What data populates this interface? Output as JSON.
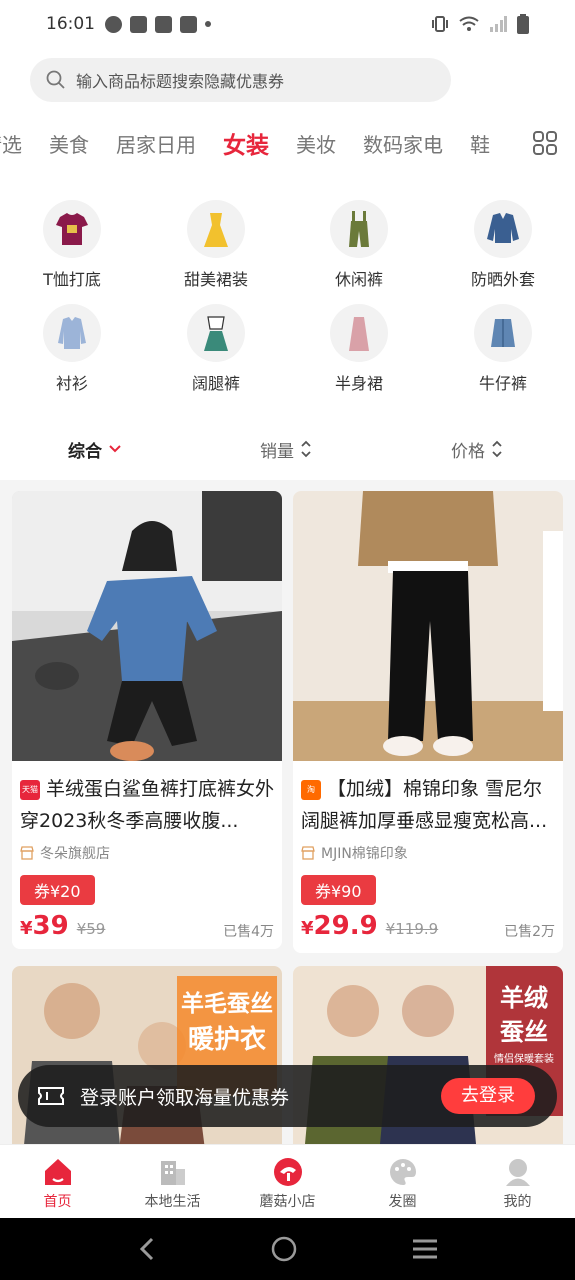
{
  "status": {
    "time": "16:01"
  },
  "search": {
    "placeholder": "输入商品标题搜索隐藏优惠券"
  },
  "categories": [
    {
      "label": "精选"
    },
    {
      "label": "美食"
    },
    {
      "label": "居家日用"
    },
    {
      "label": "女装"
    },
    {
      "label": "美妆"
    },
    {
      "label": "数码家电"
    },
    {
      "label": "鞋"
    }
  ],
  "active_category": "女装",
  "subcategories": [
    {
      "label": "T恤打底",
      "icon": "tshirt-icon"
    },
    {
      "label": "甜美裙装",
      "icon": "dress-icon"
    },
    {
      "label": "休闲裤",
      "icon": "overalls-icon"
    },
    {
      "label": "防晒外套",
      "icon": "jacket-icon"
    },
    {
      "label": "衬衫",
      "icon": "shirt-icon"
    },
    {
      "label": "阔腿裤",
      "icon": "wide-pants-icon"
    },
    {
      "label": "半身裙",
      "icon": "skirt-icon"
    },
    {
      "label": "牛仔裤",
      "icon": "denim-skirt-icon"
    }
  ],
  "sort": {
    "comprehensive": "综合",
    "sales": "销量",
    "price": "价格"
  },
  "products": [
    {
      "badge": "天猫",
      "title": "羊绒蛋白鲨鱼裤打底裤女外穿2023秋冬季高腰收腹...",
      "shop": "冬朵旗舰店",
      "coupon": "券¥20",
      "price_symbol": "¥",
      "price": "39",
      "original_price": "¥59",
      "sold": "已售4万"
    },
    {
      "badge": "淘",
      "title": "【加绒】棉锦印象 雪尼尔阔腿裤加厚垂感显瘦宽松高...",
      "shop": "MJIN棉锦印象",
      "coupon": "券¥90",
      "price_symbol": "¥",
      "price": "29.9",
      "original_price": "¥119.9",
      "sold": "已售2万"
    }
  ],
  "promo_images": {
    "left_text_1": "羊毛蚕丝",
    "left_text_2": "暖护衣",
    "right_text_1": "羊绒",
    "right_text_2": "蚕丝",
    "right_text_3": "情侣保暖套装"
  },
  "login_banner": {
    "text": "登录账户领取海量优惠券",
    "button": "去登录"
  },
  "tabbar": [
    {
      "label": "首页",
      "icon": "home-icon"
    },
    {
      "label": "本地生活",
      "icon": "building-icon"
    },
    {
      "label": "蘑菇小店",
      "icon": "shop-icon"
    },
    {
      "label": "发圈",
      "icon": "palette-icon"
    },
    {
      "label": "我的",
      "icon": "profile-icon"
    }
  ],
  "colors": {
    "accent": "#e7263c",
    "coupon": "#ea3b41"
  }
}
